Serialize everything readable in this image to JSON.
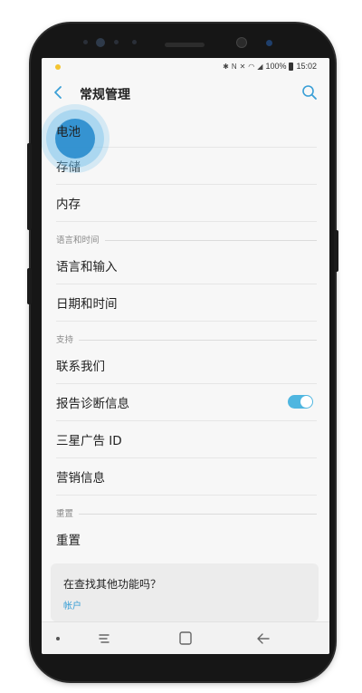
{
  "status_bar": {
    "icons": [
      "notification-dot-icon",
      "bluetooth-icon",
      "nfc-icon",
      "mute-icon",
      "wifi-icon",
      "signal-icon",
      "battery-icon"
    ],
    "battery": "100%",
    "time": "15:02"
  },
  "app_bar": {
    "title": "常规管理",
    "back_icon": "chevron-left-icon",
    "search_icon": "search-icon"
  },
  "list": {
    "items_top": [
      {
        "label": "电池"
      },
      {
        "label": "存储"
      },
      {
        "label": "内存"
      }
    ],
    "section_lang": {
      "header": "语言和时间"
    },
    "items_lang": [
      {
        "label": "语言和输入"
      },
      {
        "label": "日期和时间"
      }
    ],
    "section_support": {
      "header": "支持"
    },
    "items_support": [
      {
        "label": "联系我们"
      },
      {
        "label": "报告诊断信息",
        "toggle": true
      },
      {
        "label": "三星广告 ID"
      },
      {
        "label": "营销信息"
      }
    ],
    "section_reset": {
      "header": "重置"
    },
    "items_reset": [
      {
        "label": "重置"
      }
    ]
  },
  "card": {
    "title": "在查找其他功能吗？",
    "link": "帐户"
  },
  "nav_bar": {
    "icons": [
      "dot-icon",
      "recent-apps-icon",
      "home-icon",
      "back-arrow-icon"
    ]
  },
  "colors": {
    "accent": "#3a9fd6",
    "toggle_on": "#4fb6e0",
    "screen_bg": "#f7f7f7",
    "phone_body": "#161616",
    "touch_highlight": "#288ccd"
  }
}
